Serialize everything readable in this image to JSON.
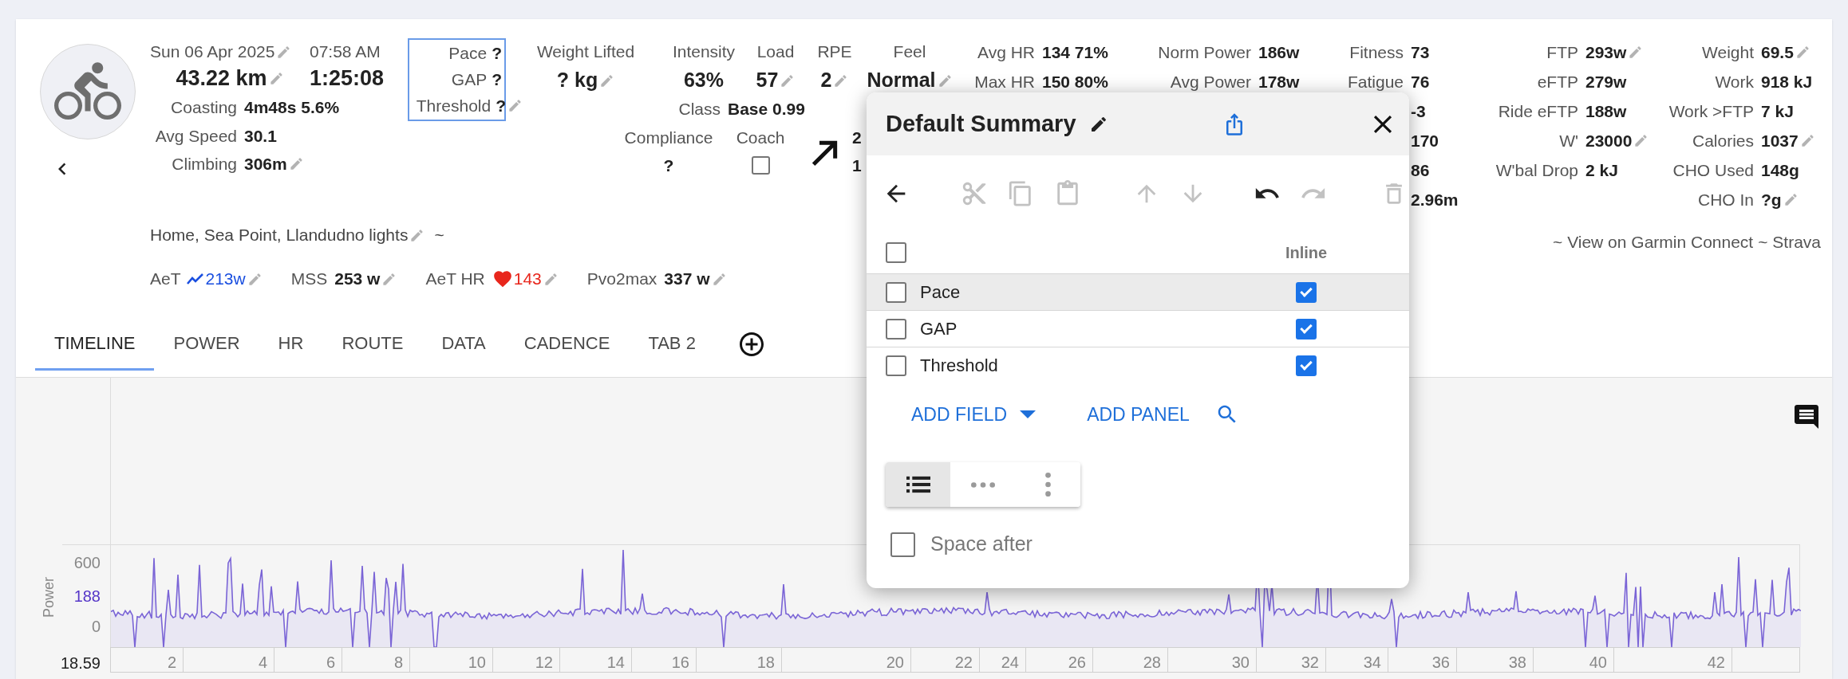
{
  "activity": {
    "date": "Sun 06 Apr 2025",
    "date_editable": true,
    "time": "07:58 AM",
    "distance": "43.22 km",
    "distance_editable": true,
    "duration": "1:25:08"
  },
  "basic_stats": [
    {
      "label": "Coasting",
      "value": "4m48s 5.6%",
      "editable": false
    },
    {
      "label": "Avg Speed",
      "value": "30.1",
      "editable": false
    },
    {
      "label": "Climbing",
      "value": "306m",
      "editable": true
    }
  ],
  "pace_box": {
    "highlighted": true,
    "fields": [
      {
        "label": "Pace",
        "value": "?",
        "editable": false
      },
      {
        "label": "GAP",
        "value": "?",
        "editable": false
      },
      {
        "label": "Threshold",
        "value": "?",
        "editable": true
      }
    ]
  },
  "top_metrics": [
    {
      "label": "Weight Lifted",
      "value": "? kg",
      "editable": true
    },
    {
      "label": "Intensity",
      "value": "63%",
      "editable": false
    },
    {
      "label": "Load",
      "value": "57",
      "editable": true
    },
    {
      "label": "RPE",
      "value": "2",
      "editable": true
    },
    {
      "label": "Feel",
      "value": "Normal",
      "editable": true
    }
  ],
  "class": {
    "label": "Class",
    "value": "Base 0.99"
  },
  "compliance": {
    "label": "Compliance",
    "value": "?"
  },
  "coach": {
    "label": "Coach",
    "checked": false
  },
  "hidden_column": [
    "2",
    "1"
  ],
  "hr": [
    {
      "label": "Avg HR",
      "value": "134 71%"
    },
    {
      "label": "Max HR",
      "value": "150 80%"
    }
  ],
  "power": [
    {
      "label": "Norm Power",
      "value": "186w"
    },
    {
      "label": "Avg Power",
      "value": "178w"
    }
  ],
  "fitness": [
    {
      "label": "Fitness",
      "value": "73"
    },
    {
      "label": "Fatigue",
      "value": "76"
    },
    {
      "value": "-3"
    },
    {
      "value": "170"
    },
    {
      "value": "86"
    },
    {
      "value": "2.96m"
    }
  ],
  "ftp": [
    {
      "label": "FTP",
      "value": "293w",
      "editable": true
    },
    {
      "label": "eFTP",
      "value": "279w",
      "editable": false
    },
    {
      "label": "Ride eFTP",
      "value": "188w",
      "editable": false
    },
    {
      "label": "W'",
      "value": "23000",
      "editable": true
    },
    {
      "label": "W'bal Drop",
      "value": "2 kJ",
      "editable": false
    }
  ],
  "body": [
    {
      "label": "Weight",
      "value": "69.5",
      "editable": true
    },
    {
      "label": "Work",
      "value": "918 kJ",
      "editable": false
    },
    {
      "label": "Work >FTP",
      "value": "7 kJ",
      "editable": false
    },
    {
      "label": "Calories",
      "value": "1037",
      "editable": true
    },
    {
      "label": "CHO Used",
      "value": "148g",
      "editable": false
    },
    {
      "label": "CHO In",
      "value": "?g",
      "editable": true
    }
  ],
  "route": {
    "name": "Home, Sea Point, Llandudno lights",
    "editable": true,
    "suffix": "~"
  },
  "links": [
    "~ View on Garmin Connect",
    "~ Strava"
  ],
  "thresholds": [
    {
      "kind": "trend",
      "label": "AeT",
      "value": "213w",
      "editable": true
    },
    {
      "kind": "plain",
      "label": "MSS",
      "value": "253 w",
      "editable": true
    },
    {
      "kind": "heart",
      "label": "AeT HR",
      "value": "143",
      "editable": true
    },
    {
      "kind": "plain",
      "label": "Pvo2max",
      "value": "337 w",
      "editable": true
    }
  ],
  "tabs": [
    {
      "label": "TIMELINE",
      "selected": true
    },
    {
      "label": "POWER",
      "selected": false
    },
    {
      "label": "HR",
      "selected": false
    },
    {
      "label": "ROUTE",
      "selected": false
    },
    {
      "label": "DATA",
      "selected": false
    },
    {
      "label": "CADENCE",
      "selected": false
    },
    {
      "label": "TAB 2",
      "selected": false
    }
  ],
  "chart": {
    "ylabel": "Power",
    "y_ticks": [
      {
        "label": "600",
        "kind": "axis"
      },
      {
        "label": "188",
        "kind": "average"
      },
      {
        "label": "0",
        "kind": "axis"
      }
    ],
    "x_start": "18.59",
    "x_labels": [
      "2",
      "4",
      "6",
      "8",
      "10",
      "12",
      "14",
      "16",
      "18",
      "20",
      "22",
      "24",
      "26",
      "28",
      "30",
      "32",
      "34",
      "36",
      "38",
      "40",
      "42"
    ]
  },
  "dialog": {
    "title": "Default Summary",
    "toolbar": [
      {
        "kind": "back",
        "disabled": false
      },
      {
        "kind": "cut",
        "disabled": true
      },
      {
        "kind": "copy",
        "disabled": true
      },
      {
        "kind": "paste",
        "disabled": true
      },
      {
        "kind": "up",
        "disabled": true
      },
      {
        "kind": "down",
        "disabled": true
      },
      {
        "kind": "undo",
        "disabled": false
      },
      {
        "kind": "redo",
        "disabled": true
      },
      {
        "kind": "delete",
        "disabled": true
      }
    ],
    "select_all_checked": false,
    "inline_header": "Inline",
    "fields": [
      {
        "label": "Pace",
        "checked": false,
        "inline": true,
        "selected": true
      },
      {
        "label": "GAP",
        "checked": false,
        "inline": true,
        "selected": false
      },
      {
        "label": "Threshold",
        "checked": false,
        "inline": true,
        "selected": false
      }
    ],
    "add_field": "ADD FIELD",
    "add_panel": "ADD PANEL",
    "layouts": [
      {
        "kind": "list",
        "selected": true
      },
      {
        "kind": "row",
        "selected": false
      },
      {
        "kind": "column",
        "selected": false
      }
    ],
    "space_after": {
      "label": "Space after",
      "checked": false
    }
  }
}
